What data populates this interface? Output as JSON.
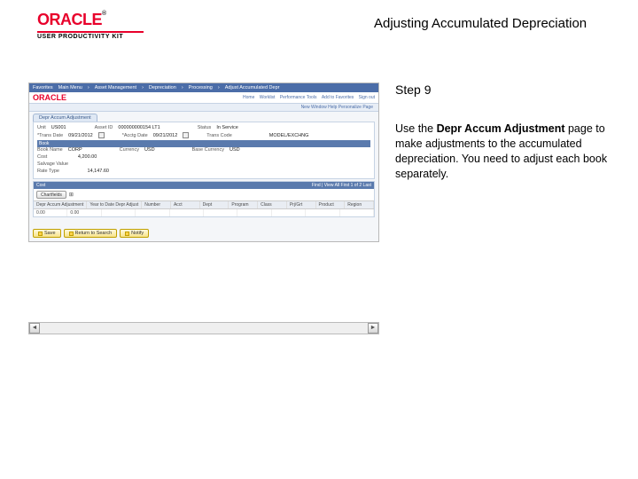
{
  "header": {
    "logo_text": "ORACLE",
    "logo_tm": "®",
    "upk_text": "USER PRODUCTIVITY KIT",
    "page_title": "Adjusting Accumulated Depreciation"
  },
  "instruction": {
    "step_label": "Step 9",
    "text_before": "Use the ",
    "bold": "Depr Accum Adjustment",
    "text_after": " page to make adjustments to the accumulated depreciation. You need to adjust each book separately."
  },
  "app": {
    "nav": [
      "Favorites",
      "Main Menu",
      "Asset Management",
      "Depreciation",
      "Processing",
      "Adjust Accumulated Depr"
    ],
    "logo": "ORACLE",
    "top_links": [
      "Home",
      "Worklist",
      "Performance Tools",
      "Add to Favorites",
      "Sign out"
    ],
    "subbar": "New Window  Help  Personalize Page",
    "tab": "Depr Accum Adjustment",
    "form": {
      "unit_label": "Unit",
      "unit_value": "US001",
      "asset_label": "Asset ID",
      "asset_value": "000000000154  LT1",
      "status_label": "Status",
      "status_value": "In Service",
      "trans_date_label": "*Trans Date",
      "trans_date_value": "09/21/2012",
      "acctg_date_label": "*Acctg Date",
      "acctg_date_value": "09/21/2012",
      "trans_code_label": "Trans Code",
      "trans_code_value": "",
      "rate_label": "Rate Type",
      "rate_value": "MODEL/EXCHNG",
      "book_section": "Book",
      "book_cols": [
        "Book Name",
        "CORP",
        "Currency",
        "USD"
      ],
      "cost_label": "Cost",
      "cost_value": "4,200.00",
      "salvage_label": "Salvage Value",
      "salvage_value": "",
      "base_curr_label": "Base Currency",
      "base_curr_value": "USD",
      "rate_type2_label": "Rate Type",
      "rate_type2_value": "14,147.60"
    },
    "cost_section": {
      "title": "Cost",
      "finder": "Find | View All   First   1 of 2   Last",
      "chartfields_btn": "Chartfields",
      "icon": "⊞",
      "cols": [
        "Depr Accum Adjustment",
        "Year to Date Depr Adjust",
        "Number",
        "Acct",
        "Dept",
        "Program",
        "Class",
        "Prj/Grt",
        "Product",
        "Region"
      ],
      "row": [
        "0.00",
        "0.00",
        "",
        "",
        "",
        "",
        "",
        "",
        "",
        ""
      ]
    },
    "bottom_buttons": {
      "save": "Save",
      "return": "Return to Search",
      "notify": "Notify"
    }
  }
}
